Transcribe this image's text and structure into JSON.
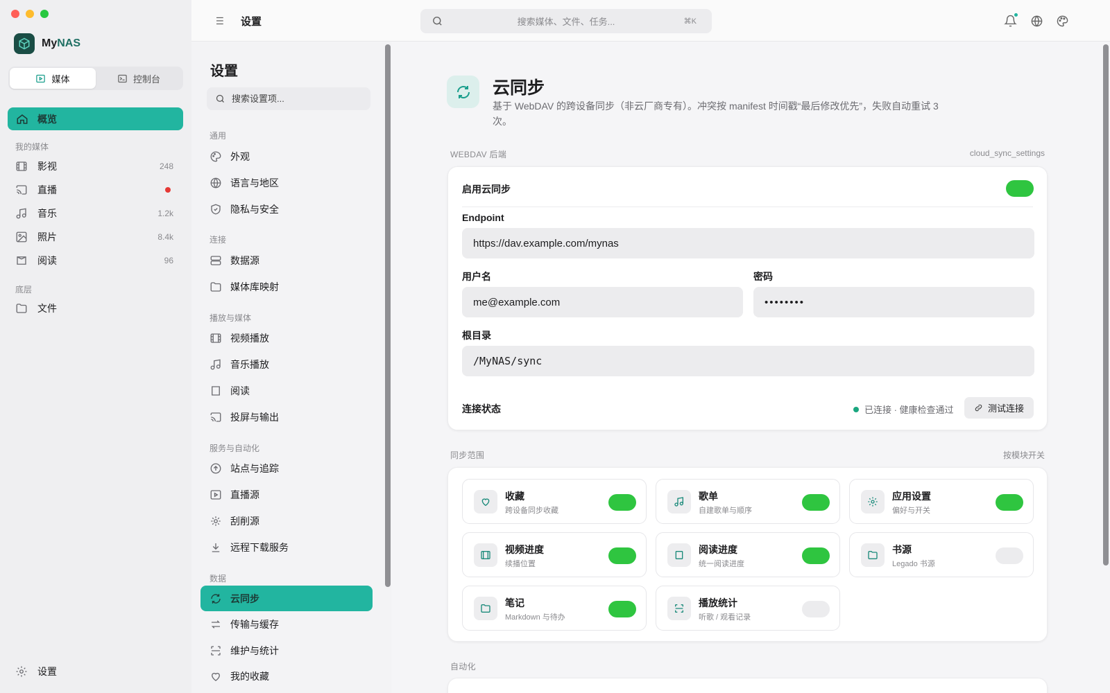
{
  "app": {
    "name_prefix": "My",
    "name_accent": "NAS",
    "traffic_colors": [
      "#ff5f57",
      "#febc2e",
      "#28c840"
    ]
  },
  "mode_tabs": [
    {
      "label": "媒体",
      "active": true
    },
    {
      "label": "控制台",
      "active": false
    }
  ],
  "sidebar": {
    "overview_label": "概览",
    "my_media_title": "我的媒体",
    "media_items": [
      {
        "label": "影视",
        "count": "248"
      },
      {
        "label": "直播",
        "count": ""
      },
      {
        "label": "音乐",
        "count": "1.2k"
      },
      {
        "label": "照片",
        "count": "8.4k"
      },
      {
        "label": "阅读",
        "count": "96"
      }
    ],
    "bottom_title": "底层",
    "files_label": "文件",
    "settings_label": "设置"
  },
  "topbar": {
    "title": "设置",
    "search_placeholder": "搜索媒体、文件、任务...",
    "search_shortcut": "⌘K"
  },
  "settings_nav": {
    "title": "设置",
    "search_placeholder": "搜索设置项...",
    "groups": [
      {
        "title": "通用",
        "items": [
          "外观",
          "语言与地区",
          "隐私与安全"
        ]
      },
      {
        "title": "连接",
        "items": [
          "数据源",
          "媒体库映射"
        ]
      },
      {
        "title": "播放与媒体",
        "items": [
          "视频播放",
          "音乐播放",
          "阅读",
          "投屏与输出"
        ]
      },
      {
        "title": "服务与自动化",
        "items": [
          "站点与追踪",
          "直播源",
          "刮削源",
          "远程下载服务"
        ]
      },
      {
        "title": "数据",
        "items": [
          "云同步",
          "传输与缓存",
          "维护与统计",
          "我的收藏"
        ]
      }
    ],
    "active_item": "云同步"
  },
  "page": {
    "title": "云同步",
    "description": "基于 WebDAV 的跨设备同步（非云厂商专有）。冲突按 manifest 时间戳“最后修改优先”，失败自动重试 3 次。",
    "webdav_section_label": "WEBDAV 后端",
    "webdav_section_key": "cloud_sync_settings",
    "enable_label": "启用云同步",
    "enable_on": true,
    "endpoint_label": "Endpoint",
    "endpoint_value": "https://dav.example.com/mynas",
    "username_label": "用户名",
    "username_value": "me@example.com",
    "password_label": "密码",
    "password_value": "••••••••",
    "root_label": "根目录",
    "root_value": "/MyNAS/sync",
    "conn_status_label": "连接状态",
    "conn_status_text": "已连接 · 健康检查通过",
    "test_button": "测试连接",
    "scope_section_label": "同步范围",
    "scope_section_right": "按模块开关",
    "modules": [
      {
        "title": "收藏",
        "subtitle": "跨设备同步收藏",
        "icon": "heart-icon",
        "enabled": true
      },
      {
        "title": "歌单",
        "subtitle": "自建歌单与顺序",
        "icon": "music-note-icon",
        "enabled": true
      },
      {
        "title": "应用设置",
        "subtitle": "偏好与开关",
        "icon": "gear-icon",
        "enabled": true
      },
      {
        "title": "视频进度",
        "subtitle": "续播位置",
        "icon": "film-icon",
        "enabled": true
      },
      {
        "title": "阅读进度",
        "subtitle": "统一阅读进度",
        "icon": "book-icon",
        "enabled": true
      },
      {
        "title": "书源",
        "subtitle": "Legado 书源",
        "icon": "folder-icon",
        "enabled": false
      },
      {
        "title": "笔记",
        "subtitle": "Markdown 与待办",
        "icon": "folder-icon",
        "enabled": true
      },
      {
        "title": "播放统计",
        "subtitle": "听歌 / 观看记录",
        "icon": "scan-icon",
        "enabled": false
      }
    ],
    "automation_section_label": "自动化"
  },
  "colors": {
    "accent": "#22b5a0",
    "toggle_on": "#2fc540",
    "brand_dark": "#1a4d45"
  }
}
